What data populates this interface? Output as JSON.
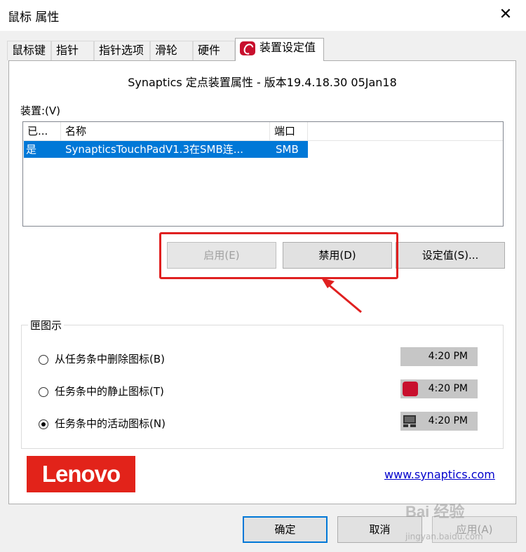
{
  "window": {
    "title": "鼠标 属性",
    "close_symbol": "✕"
  },
  "tabs": [
    {
      "label": "鼠标键"
    },
    {
      "label": "指针"
    },
    {
      "label": "指针选项"
    },
    {
      "label": "滑轮"
    },
    {
      "label": "硬件"
    },
    {
      "label": "装置设定值",
      "active": true
    }
  ],
  "header": {
    "text": "Synaptics 定点装置属性 - 版本19.4.18.30 05Jan18"
  },
  "devices": {
    "label": "装置:(V)",
    "columns": [
      "已...",
      "名称",
      "端口"
    ],
    "rows": [
      {
        "enabled": "是",
        "name": "SynapticsTouchPadV1.3在SMB连...",
        "port": "SMB"
      }
    ]
  },
  "buttons": {
    "enable": "启用(E)",
    "disable": "禁用(D)",
    "settings": "设定值(S)..."
  },
  "tray_icon": {
    "title": "匣图示",
    "options": [
      {
        "label": "从任务条中删除图标(B)",
        "selected": false,
        "time": "4:20 PM",
        "icon": "none"
      },
      {
        "label": "任务条中的静止图标(T)",
        "selected": false,
        "time": "4:20 PM",
        "icon": "synaptics-icon"
      },
      {
        "label": "任务条中的活动图标(N)",
        "selected": true,
        "time": "4:20 PM",
        "icon": "touchpad-activity-icon"
      }
    ]
  },
  "brand": {
    "logo_text": "Lenovo",
    "logo_color": "#e2231a"
  },
  "link": {
    "text": "www.synaptics.com"
  },
  "footer": {
    "ok": "确定",
    "cancel": "取消",
    "apply": "应用(A)"
  },
  "watermark": {
    "text": "Bai 经验",
    "sub": "jingyan.baidu.com"
  },
  "colors": {
    "selection": "#0078d7",
    "highlight_box": "#e02020",
    "focus_border": "#0078d7"
  }
}
